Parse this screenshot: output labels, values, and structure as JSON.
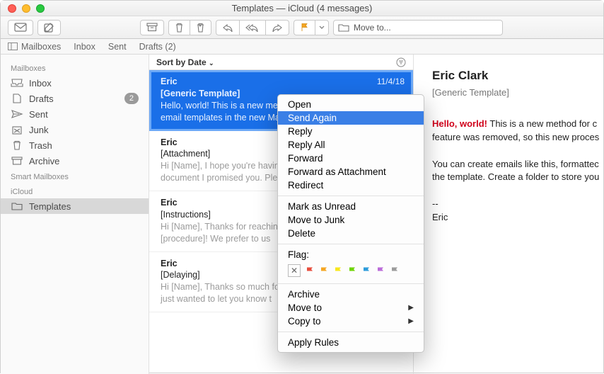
{
  "window": {
    "title": "Templates — iCloud (4 messages)"
  },
  "toolbar": {
    "move_to": "Move to..."
  },
  "favbar": {
    "mailboxes": "Mailboxes",
    "inbox": "Inbox",
    "sent": "Sent",
    "drafts": "Drafts (2)"
  },
  "sidebar": {
    "group_mailboxes": "Mailboxes",
    "group_smart": "Smart Mailboxes",
    "group_icloud": "iCloud",
    "inbox": "Inbox",
    "drafts": "Drafts",
    "drafts_badge": "2",
    "sent": "Sent",
    "junk": "Junk",
    "trash": "Trash",
    "archive": "Archive",
    "templates": "Templates"
  },
  "sortbar": {
    "label": "Sort by Date"
  },
  "messages": [
    {
      "from": "Eric",
      "subject": "[Generic Template]",
      "date": "11/4/18",
      "preview": "Hello, world! This is a new method for creating and using email templates in the new Mac Mail app."
    },
    {
      "from": "Eric",
      "subject": "[Attachment]",
      "date": "",
      "preview": "Hi [Name], I hope you're having a great day! Attached is the document I promised you. Please"
    },
    {
      "from": "Eric",
      "subject": "[Instructions]",
      "date": "",
      "preview": "Hi [Name], Thanks for reaching out about how to do [procedure]! We prefer to us"
    },
    {
      "from": "Eric",
      "subject": "[Delaying]",
      "date": "",
      "preview": "Hi [Name], Thanks so much for reaching out about [topic]! I just wanted to let you know t"
    }
  ],
  "reader": {
    "from": "Eric Clark",
    "subject": "[Generic Template]",
    "hello": "Hello, world!",
    "line1_rest": " This is a new method for c",
    "line2": "feature was removed, so this new proces",
    "para2a": "You can create emails like this, formattec",
    "para2b": "the template. Create a folder to store you",
    "sigdash": "--",
    "signame": "Eric"
  },
  "context_menu": {
    "open": "Open",
    "send_again": "Send Again",
    "reply": "Reply",
    "reply_all": "Reply All",
    "forward": "Forward",
    "forward_attachment": "Forward as Attachment",
    "redirect": "Redirect",
    "mark_unread": "Mark as Unread",
    "move_junk": "Move to Junk",
    "delete": "Delete",
    "flag_label": "Flag:",
    "archive": "Archive",
    "move_to": "Move to",
    "copy_to": "Copy to",
    "apply_rules": "Apply Rules",
    "flag_colors": [
      "#e74c3c",
      "#f5a623",
      "#f8e71c",
      "#6dd400",
      "#2d9cdb",
      "#bb6bd9",
      "#9b9b9b"
    ]
  }
}
